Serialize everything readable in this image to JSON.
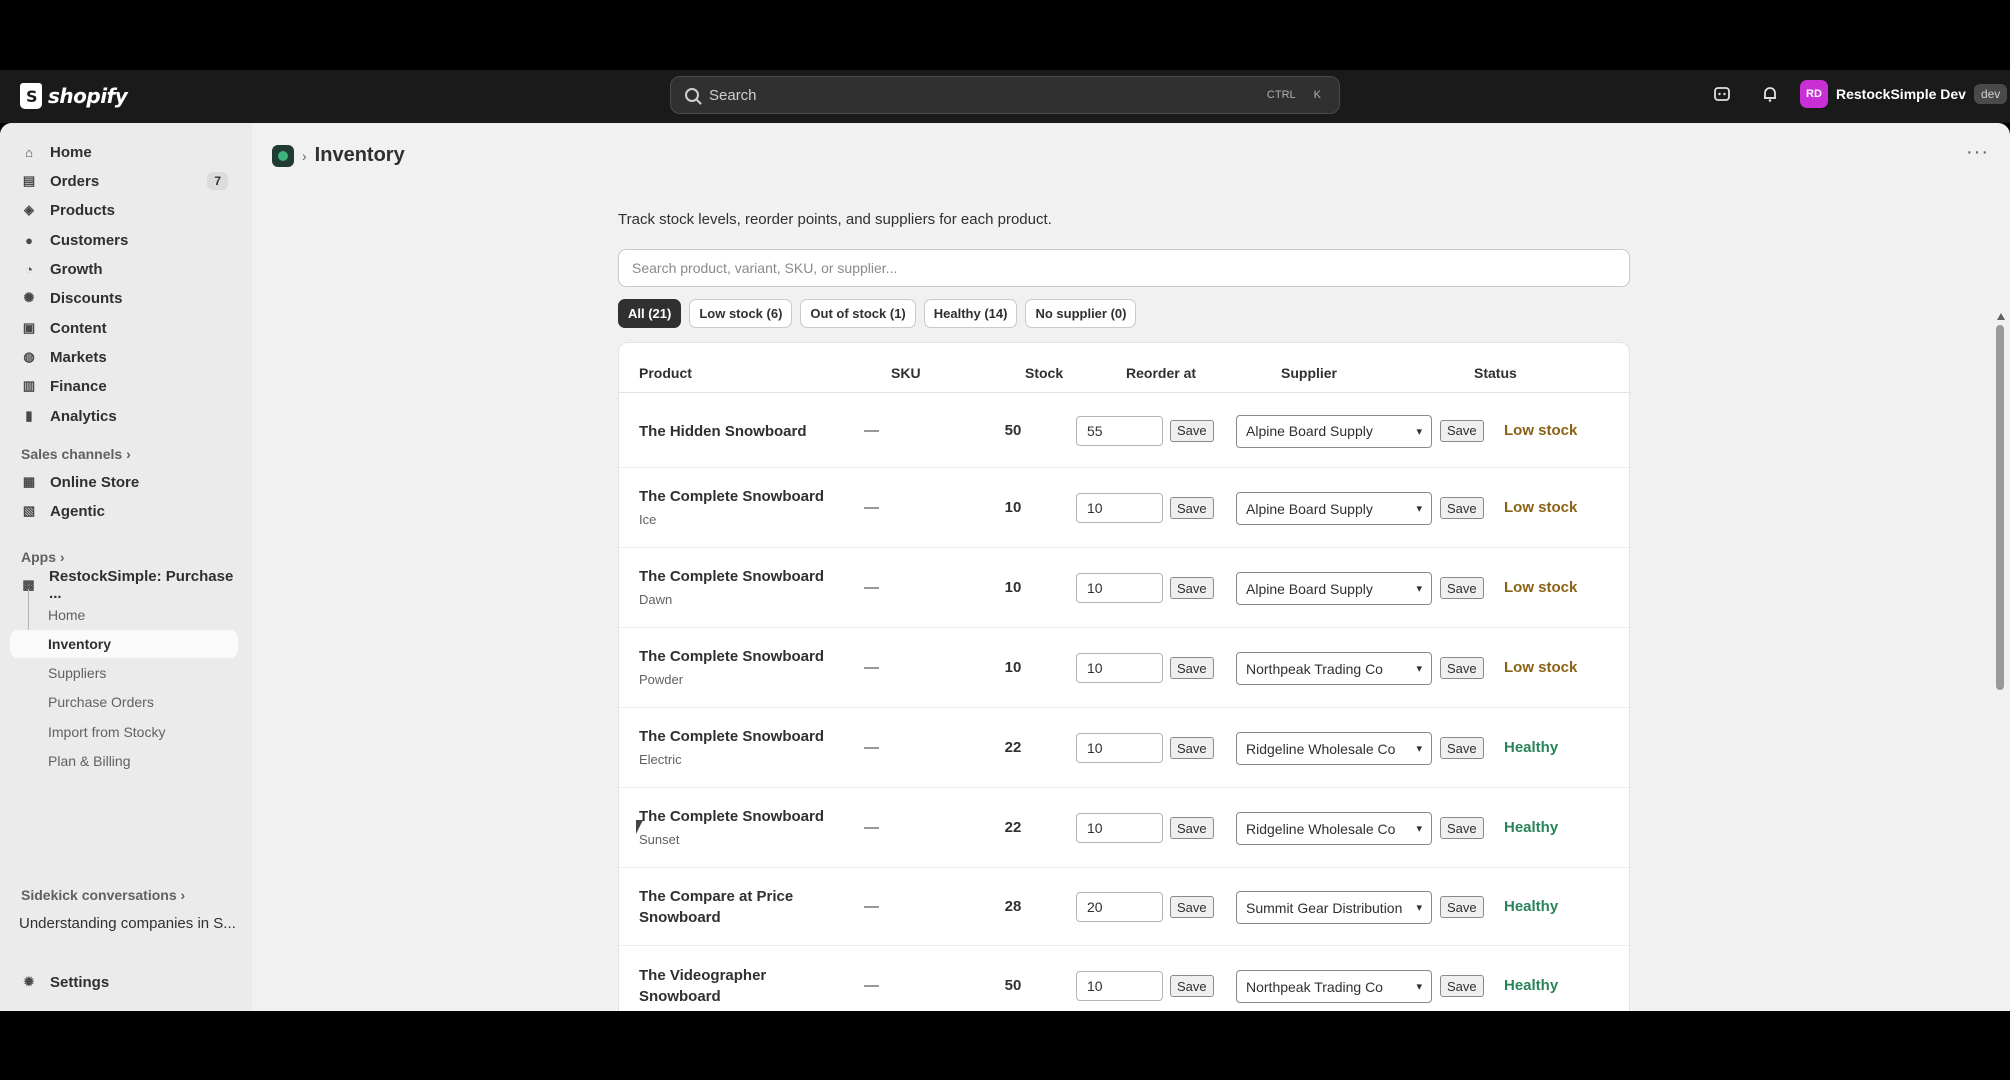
{
  "topbar": {
    "logo_text": "shopify",
    "search_placeholder": "Search",
    "search_shortcut_mod": "CTRL",
    "search_shortcut_key": "K",
    "user_initials": "RD",
    "user_name": "RestockSimple Dev",
    "user_badge": "dev",
    "avatar_color": "#c82fd5"
  },
  "sidebar": {
    "items": [
      {
        "label": "Home",
        "icon": "home-icon"
      },
      {
        "label": "Orders",
        "icon": "inbox-icon",
        "badge": "7"
      },
      {
        "label": "Products",
        "icon": "tag-icon"
      },
      {
        "label": "Customers",
        "icon": "person-icon"
      },
      {
        "label": "Growth",
        "icon": "growth-icon"
      },
      {
        "label": "Discounts",
        "icon": "discount-icon"
      },
      {
        "label": "Content",
        "icon": "content-icon"
      },
      {
        "label": "Markets",
        "icon": "globe-icon"
      },
      {
        "label": "Finance",
        "icon": "bank-icon"
      },
      {
        "label": "Analytics",
        "icon": "chart-icon"
      }
    ],
    "sales_channels_label": "Sales channels",
    "channels": [
      {
        "label": "Online Store",
        "icon": "store-icon"
      },
      {
        "label": "Agentic",
        "icon": "agentic-icon"
      }
    ],
    "apps_label": "Apps",
    "app_name": "RestockSimple: Purchase ...",
    "app_subitems": [
      "Home",
      "Inventory",
      "Suppliers",
      "Purchase Orders",
      "Import from Stocky",
      "Plan & Billing"
    ],
    "sidekick_label": "Sidekick conversations",
    "sidekick_item": "Understanding companies in S...",
    "settings_label": "Settings"
  },
  "page": {
    "title": "Inventory",
    "intro": "Track stock levels, reorder points, and suppliers for each product.",
    "filter_placeholder": "Search product, variant, SKU, or supplier...",
    "pills": [
      "All (21)",
      "Low stock (6)",
      "Out of stock (1)",
      "Healthy (14)",
      "No supplier (0)"
    ],
    "columns": [
      "Product",
      "SKU",
      "Stock",
      "Reorder at",
      "Supplier",
      "Status"
    ],
    "save_label": "Save",
    "status_colors": {
      "low": "#8a6116",
      "healthy": "#29845a"
    },
    "rows": [
      {
        "name": "The Hidden Snowboard",
        "variant": "",
        "sku": "—",
        "stock": "50",
        "reorder": "55",
        "supplier": "Alpine Board Supply",
        "status": "Low stock"
      },
      {
        "name": "The Complete Snowboard",
        "variant": "Ice",
        "sku": "—",
        "stock": "10",
        "reorder": "10",
        "supplier": "Alpine Board Supply",
        "status": "Low stock"
      },
      {
        "name": "The Complete Snowboard",
        "variant": "Dawn",
        "sku": "—",
        "stock": "10",
        "reorder": "10",
        "supplier": "Alpine Board Supply",
        "status": "Low stock"
      },
      {
        "name": "The Complete Snowboard",
        "variant": "Powder",
        "sku": "—",
        "stock": "10",
        "reorder": "10",
        "supplier": "Northpeak Trading Co",
        "status": "Low stock"
      },
      {
        "name": "The Complete Snowboard",
        "variant": "Electric",
        "sku": "—",
        "stock": "22",
        "reorder": "10",
        "supplier": "Ridgeline Wholesale Co",
        "status": "Healthy"
      },
      {
        "name": "The Complete Snowboard",
        "variant": "Sunset",
        "sku": "—",
        "stock": "22",
        "reorder": "10",
        "supplier": "Ridgeline Wholesale Co",
        "status": "Healthy"
      },
      {
        "name": "The Compare at Price Snowboard",
        "variant": "",
        "sku": "—",
        "stock": "28",
        "reorder": "20",
        "supplier": "Summit Gear Distribution",
        "status": "Healthy"
      },
      {
        "name": "The Videographer Snowboard",
        "variant": "",
        "sku": "—",
        "stock": "50",
        "reorder": "10",
        "supplier": "Northpeak Trading Co",
        "status": "Healthy"
      }
    ]
  }
}
